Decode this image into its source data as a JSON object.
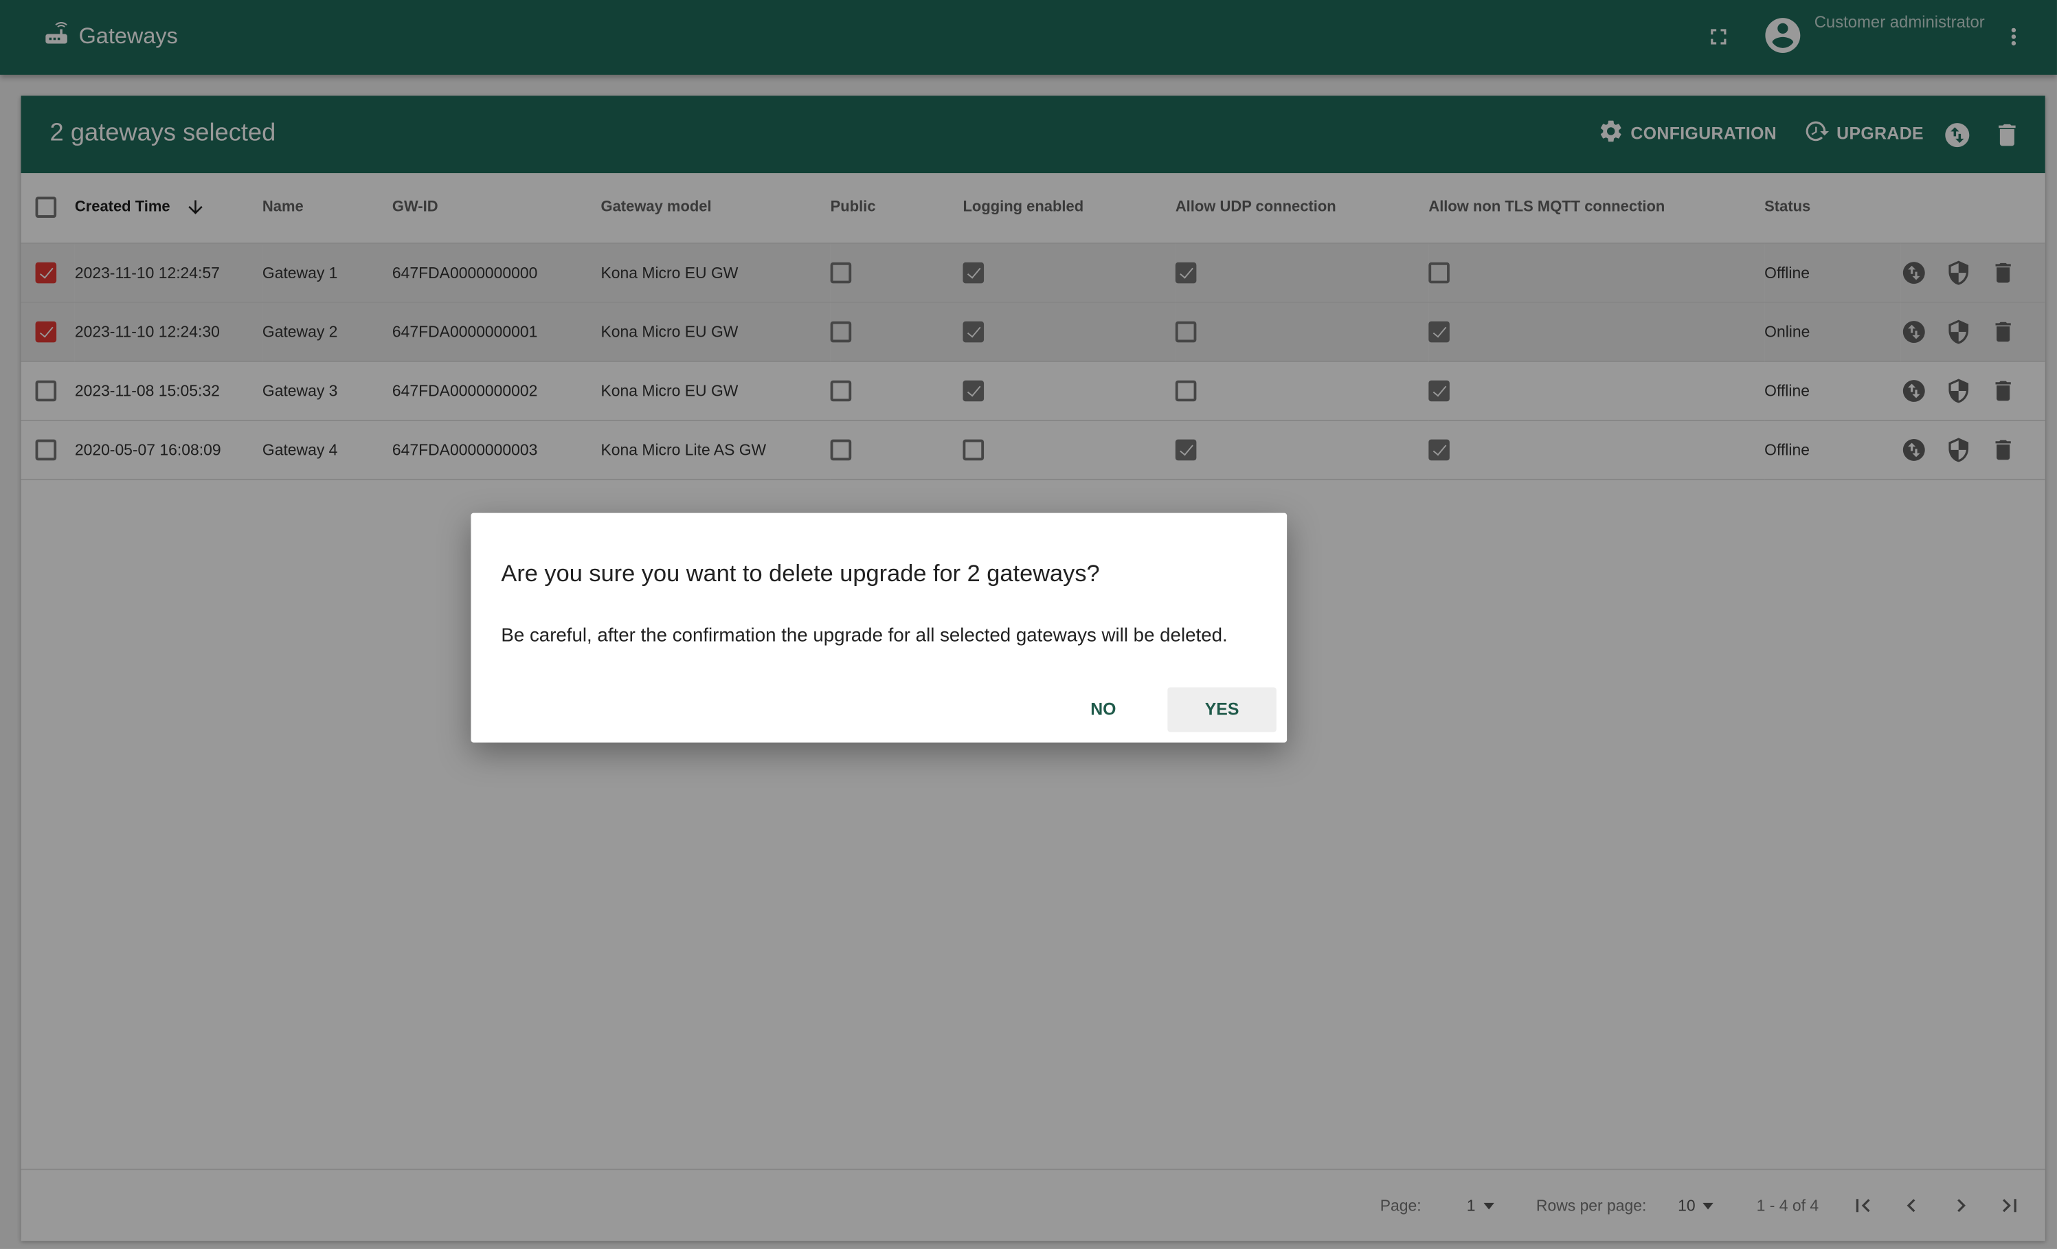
{
  "topbar": {
    "title": "Gateways",
    "title_icon": "router-icon",
    "user_label": "Customer administrator",
    "icons": [
      "fullscreen-icon",
      "account-circle-icon",
      "more-vert-icon"
    ]
  },
  "selection_bar": {
    "title": "2 gateways selected",
    "configuration_label": "CONFIGURATION",
    "upgrade_label": "UPGRADE",
    "icons": [
      "settings-icon",
      "upgrade-history-icon",
      "swap-vert-circle-icon",
      "delete-icon"
    ]
  },
  "table": {
    "columns": [
      "Created Time",
      "Name",
      "GW-ID",
      "Gateway model",
      "Public",
      "Logging enabled",
      "Allow UDP connection",
      "Allow non TLS MQTT connection",
      "Status"
    ],
    "sort": {
      "column": "Created Time",
      "direction": "descending"
    },
    "rows": [
      {
        "selected": true,
        "created": "2023-11-10 12:24:57",
        "name": "Gateway 1",
        "gw_id": "647FDA0000000000",
        "model": "Kona Micro EU GW",
        "public": false,
        "logging": true,
        "udp": true,
        "non_tls_mqtt": false,
        "status": "Offline"
      },
      {
        "selected": true,
        "created": "2023-11-10 12:24:30",
        "name": "Gateway 2",
        "gw_id": "647FDA0000000001",
        "model": "Kona Micro EU GW",
        "public": false,
        "logging": true,
        "udp": false,
        "non_tls_mqtt": true,
        "status": "Online"
      },
      {
        "selected": false,
        "created": "2023-11-08 15:05:32",
        "name": "Gateway 3",
        "gw_id": "647FDA0000000002",
        "model": "Kona Micro EU GW",
        "public": false,
        "logging": true,
        "udp": false,
        "non_tls_mqtt": true,
        "status": "Offline"
      },
      {
        "selected": false,
        "created": "2020-05-07 16:08:09",
        "name": "Gateway 4",
        "gw_id": "647FDA0000000003",
        "model": "Kona Micro Lite AS GW",
        "public": false,
        "logging": false,
        "udp": true,
        "non_tls_mqtt": true,
        "status": "Offline"
      }
    ],
    "row_action_icons": [
      "swap-vert-circle-icon",
      "security-shield-icon",
      "delete-icon"
    ]
  },
  "pagination": {
    "page_label": "Page:",
    "page_value": "1",
    "rows_per_page_label": "Rows per page:",
    "rows_per_page_value": "10",
    "range": "1 - 4 of 4"
  },
  "dialog": {
    "title": "Are you sure you want to delete upgrade for 2 gateways?",
    "body": "Be careful, after the confirmation the upgrade for all selected gateways will be deleted.",
    "no_label": "NO",
    "yes_label": "YES"
  },
  "colors": {
    "primary": "#1f6b5a",
    "offline": "#c62828",
    "online": "#2e7d32",
    "selected_checkbox": "#e53935"
  }
}
